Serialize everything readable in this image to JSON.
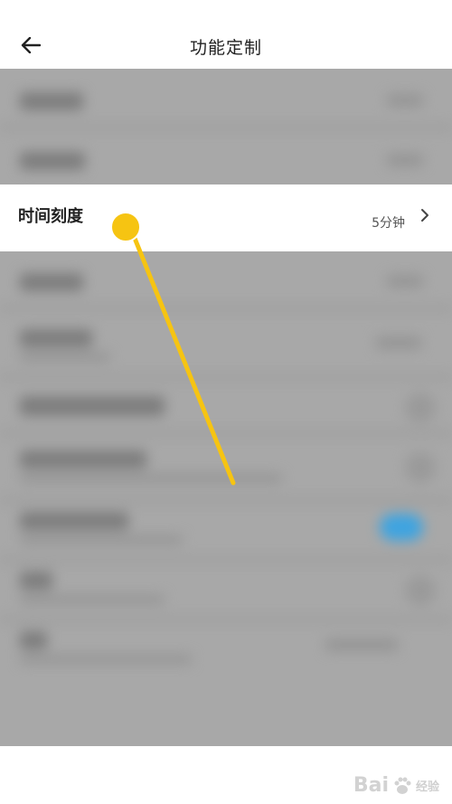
{
  "header": {
    "title": "功能定制",
    "back_icon": "arrow-left-icon"
  },
  "highlighted_item": {
    "label": "时间刻度",
    "value": "5分钟",
    "chevron_icon": "chevron-right-icon"
  },
  "watermark": {
    "brand": "Bai",
    "paw_icon": "baidu-paw-icon",
    "suffix": "经验"
  },
  "colors": {
    "overlay_gray": "#a8a8a8",
    "annotation_yellow": "#f6c412",
    "toggle_blue": "#3fa4e0"
  }
}
